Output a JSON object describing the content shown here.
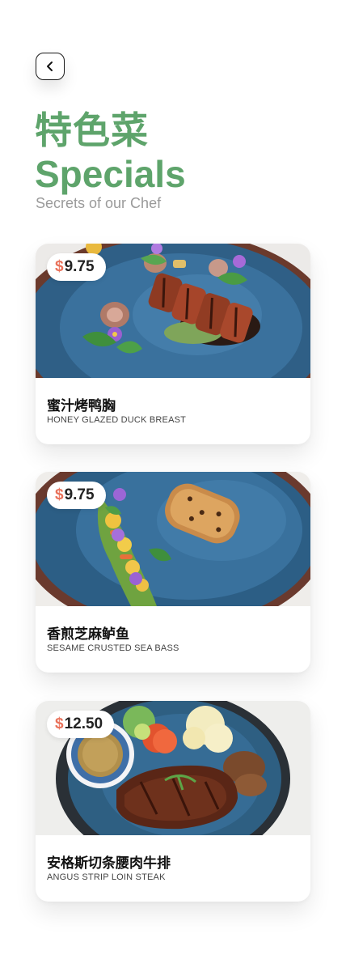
{
  "header": {
    "title_zh": "特色菜",
    "title_en": "Specials",
    "subtitle": "Secrets of our Chef"
  },
  "dishes": [
    {
      "currency": "$",
      "price": "9.75",
      "name_zh": "蜜汁烤鸭胸",
      "name_en": "HONEY GLAZED DUCK BREAST"
    },
    {
      "currency": "$",
      "price": "9.75",
      "name_zh": "香煎芝麻鲈鱼",
      "name_en": "SESAME CRUSTED SEA BASS"
    },
    {
      "currency": "$",
      "price": "12.50",
      "name_zh": "安格斯切条腰肉牛排",
      "name_en": "ANGUS STRIP LOIN STEAK"
    }
  ],
  "colors": {
    "accent_green": "#5ea46b",
    "price_currency": "#e9715a",
    "subtitle_gray": "#9a9a9a"
  },
  "icons": {
    "back": "chevron-left-icon"
  }
}
